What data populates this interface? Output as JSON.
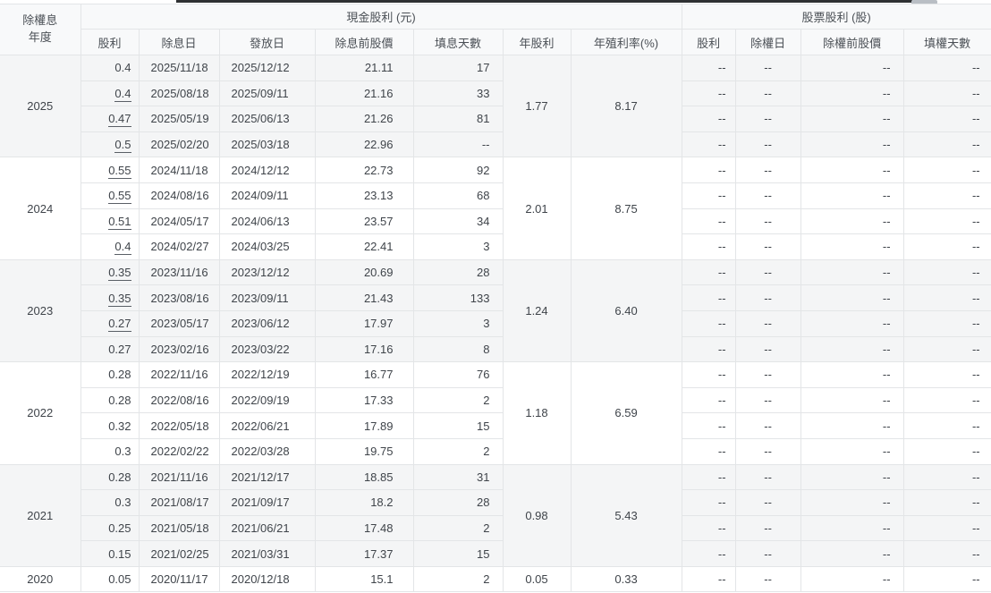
{
  "colors": {
    "header_bg": "#f8f9fa",
    "shaded_group_bg": "#f4f5f6",
    "border": "#e3e5e7",
    "text": "#3f444a",
    "top_bar": "#2f3133",
    "scroll_thumb": "#b9bec4"
  },
  "table": {
    "corner_header": {
      "line1": "除權息",
      "line2": "年度"
    },
    "sections": [
      {
        "label": "現金股利 (元)"
      },
      {
        "label": "股票股利 (股)"
      }
    ],
    "columns": {
      "cash_dividend": "股利",
      "ex_dividend_date": "除息日",
      "pay_date": "發放日",
      "price_before_ex": "除息前股價",
      "fill_days": "填息天數",
      "annual_dividend": "年股利",
      "annual_yield": "年殖利率(%)",
      "stock_dividend": "股利",
      "ex_rights_date": "除權日",
      "price_before_rights": "除權前股價",
      "fill_rights_days": "填權天數"
    },
    "groups": [
      {
        "year": "2025",
        "annual_dividend": "1.77",
        "annual_yield": "8.17",
        "rows": [
          {
            "dividend": "0.4",
            "linked": false,
            "ex_date": "2025/11/18",
            "pay_date": "2025/12/12",
            "price": "21.11",
            "fill_days": "17",
            "stock": [
              "--",
              "--",
              "--",
              "--"
            ]
          },
          {
            "dividend": "0.4",
            "linked": true,
            "ex_date": "2025/08/18",
            "pay_date": "2025/09/11",
            "price": "21.16",
            "fill_days": "33",
            "stock": [
              "--",
              "--",
              "--",
              "--"
            ]
          },
          {
            "dividend": "0.47",
            "linked": true,
            "ex_date": "2025/05/19",
            "pay_date": "2025/06/13",
            "price": "21.26",
            "fill_days": "81",
            "stock": [
              "--",
              "--",
              "--",
              "--"
            ]
          },
          {
            "dividend": "0.5",
            "linked": true,
            "ex_date": "2025/02/20",
            "pay_date": "2025/03/18",
            "price": "22.96",
            "fill_days": "--",
            "stock": [
              "--",
              "--",
              "--",
              "--"
            ]
          }
        ]
      },
      {
        "year": "2024",
        "annual_dividend": "2.01",
        "annual_yield": "8.75",
        "rows": [
          {
            "dividend": "0.55",
            "linked": true,
            "ex_date": "2024/11/18",
            "pay_date": "2024/12/12",
            "price": "22.73",
            "fill_days": "92",
            "stock": [
              "--",
              "--",
              "--",
              "--"
            ]
          },
          {
            "dividend": "0.55",
            "linked": true,
            "ex_date": "2024/08/16",
            "pay_date": "2024/09/11",
            "price": "23.13",
            "fill_days": "68",
            "stock": [
              "--",
              "--",
              "--",
              "--"
            ]
          },
          {
            "dividend": "0.51",
            "linked": true,
            "ex_date": "2024/05/17",
            "pay_date": "2024/06/13",
            "price": "23.57",
            "fill_days": "34",
            "stock": [
              "--",
              "--",
              "--",
              "--"
            ]
          },
          {
            "dividend": "0.4",
            "linked": true,
            "ex_date": "2024/02/27",
            "pay_date": "2024/03/25",
            "price": "22.41",
            "fill_days": "3",
            "stock": [
              "--",
              "--",
              "--",
              "--"
            ]
          }
        ]
      },
      {
        "year": "2023",
        "annual_dividend": "1.24",
        "annual_yield": "6.40",
        "rows": [
          {
            "dividend": "0.35",
            "linked": true,
            "ex_date": "2023/11/16",
            "pay_date": "2023/12/12",
            "price": "20.69",
            "fill_days": "28",
            "stock": [
              "--",
              "--",
              "--",
              "--"
            ]
          },
          {
            "dividend": "0.35",
            "linked": true,
            "ex_date": "2023/08/16",
            "pay_date": "2023/09/11",
            "price": "21.43",
            "fill_days": "133",
            "stock": [
              "--",
              "--",
              "--",
              "--"
            ]
          },
          {
            "dividend": "0.27",
            "linked": true,
            "ex_date": "2023/05/17",
            "pay_date": "2023/06/12",
            "price": "17.97",
            "fill_days": "3",
            "stock": [
              "--",
              "--",
              "--",
              "--"
            ]
          },
          {
            "dividend": "0.27",
            "linked": false,
            "ex_date": "2023/02/16",
            "pay_date": "2023/03/22",
            "price": "17.16",
            "fill_days": "8",
            "stock": [
              "--",
              "--",
              "--",
              "--"
            ]
          }
        ]
      },
      {
        "year": "2022",
        "annual_dividend": "1.18",
        "annual_yield": "6.59",
        "rows": [
          {
            "dividend": "0.28",
            "linked": false,
            "ex_date": "2022/11/16",
            "pay_date": "2022/12/19",
            "price": "16.77",
            "fill_days": "76",
            "stock": [
              "--",
              "--",
              "--",
              "--"
            ]
          },
          {
            "dividend": "0.28",
            "linked": false,
            "ex_date": "2022/08/16",
            "pay_date": "2022/09/19",
            "price": "17.33",
            "fill_days": "2",
            "stock": [
              "--",
              "--",
              "--",
              "--"
            ]
          },
          {
            "dividend": "0.32",
            "linked": false,
            "ex_date": "2022/05/18",
            "pay_date": "2022/06/21",
            "price": "17.89",
            "fill_days": "15",
            "stock": [
              "--",
              "--",
              "--",
              "--"
            ]
          },
          {
            "dividend": "0.3",
            "linked": false,
            "ex_date": "2022/02/22",
            "pay_date": "2022/03/28",
            "price": "19.75",
            "fill_days": "2",
            "stock": [
              "--",
              "--",
              "--",
              "--"
            ]
          }
        ]
      },
      {
        "year": "2021",
        "annual_dividend": "0.98",
        "annual_yield": "5.43",
        "rows": [
          {
            "dividend": "0.28",
            "linked": false,
            "ex_date": "2021/11/16",
            "pay_date": "2021/12/17",
            "price": "18.85",
            "fill_days": "31",
            "stock": [
              "--",
              "--",
              "--",
              "--"
            ]
          },
          {
            "dividend": "0.3",
            "linked": false,
            "ex_date": "2021/08/17",
            "pay_date": "2021/09/17",
            "price": "18.2",
            "fill_days": "28",
            "stock": [
              "--",
              "--",
              "--",
              "--"
            ]
          },
          {
            "dividend": "0.25",
            "linked": false,
            "ex_date": "2021/05/18",
            "pay_date": "2021/06/21",
            "price": "17.48",
            "fill_days": "2",
            "stock": [
              "--",
              "--",
              "--",
              "--"
            ]
          },
          {
            "dividend": "0.15",
            "linked": false,
            "ex_date": "2021/02/25",
            "pay_date": "2021/03/31",
            "price": "17.37",
            "fill_days": "15",
            "stock": [
              "--",
              "--",
              "--",
              "--"
            ]
          }
        ]
      },
      {
        "year": "2020",
        "annual_dividend": "0.05",
        "annual_yield": "0.33",
        "rows": [
          {
            "dividend": "0.05",
            "linked": false,
            "ex_date": "2020/11/17",
            "pay_date": "2020/12/18",
            "price": "15.1",
            "fill_days": "2",
            "stock": [
              "--",
              "--",
              "--",
              "--"
            ]
          }
        ]
      }
    ]
  }
}
